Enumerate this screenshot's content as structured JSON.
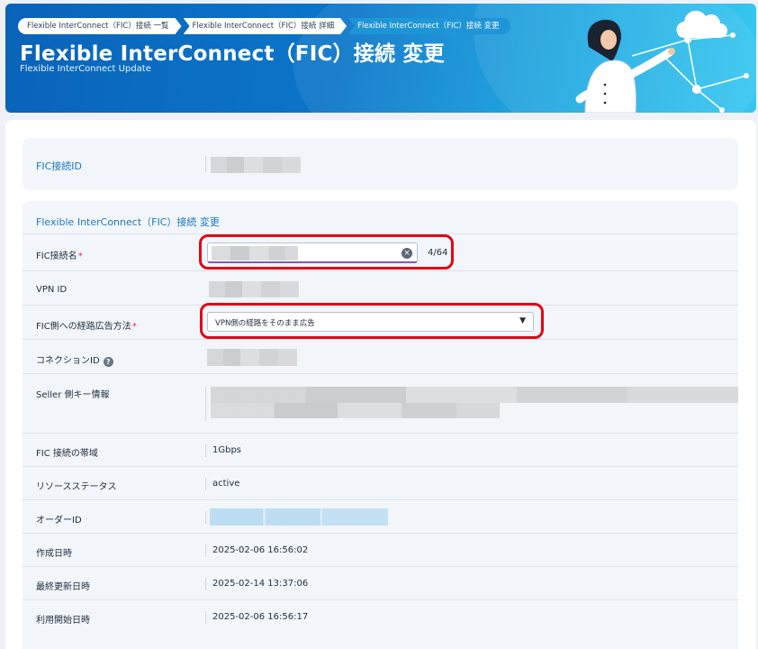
{
  "breadcrumbs": [
    {
      "label": "Flexible InterConnect（FIC）接続 一覧"
    },
    {
      "label": "Flexible InterConnect（FIC）接続 詳細"
    },
    {
      "label": "Flexible InterConnect（FIC）接続 変更"
    }
  ],
  "header": {
    "title": "Flexible InterConnect（FIC）接続 変更",
    "subtitle": "Flexible InterConnect Update"
  },
  "id_panel": {
    "label": "FIC接続ID"
  },
  "form": {
    "section_title": "Flexible InterConnect（FIC）接続 変更",
    "fields": {
      "name": {
        "label": "FIC接続名",
        "required_mark": "*",
        "counter": "4/64",
        "clear_icon": "clear-circle-icon"
      },
      "vpn_id": {
        "label": "VPN ID"
      },
      "route_ad": {
        "label": "FIC側への経路広告方法",
        "required_mark": "*",
        "selected": "VPN側の経路をそのまま広告",
        "arrow_icon": "caret-down-icon"
      },
      "connection_id": {
        "label": "コネクションID",
        "help_icon": "question-circle-icon"
      },
      "seller_key": {
        "label": "Seller 側キー情報"
      },
      "bandwidth": {
        "label": "FIC 接続の帯域",
        "value": "1Gbps"
      },
      "resource_status": {
        "label": "リソースステータス",
        "value": "active"
      },
      "order_id": {
        "label": "オーダーID"
      },
      "created_at": {
        "label": "作成日時",
        "value": "2025-02-06 16:56:02"
      },
      "updated_at": {
        "label": "最終更新日時",
        "value": "2025-02-14 13:37:06"
      },
      "started_at": {
        "label": "利用開始日時",
        "value": "2025-02-06 16:56:17"
      }
    }
  },
  "colors": {
    "accent": "#1b78c4",
    "banner": "#0b76c9",
    "required": "#e0294f",
    "highlight": "#e30613"
  }
}
